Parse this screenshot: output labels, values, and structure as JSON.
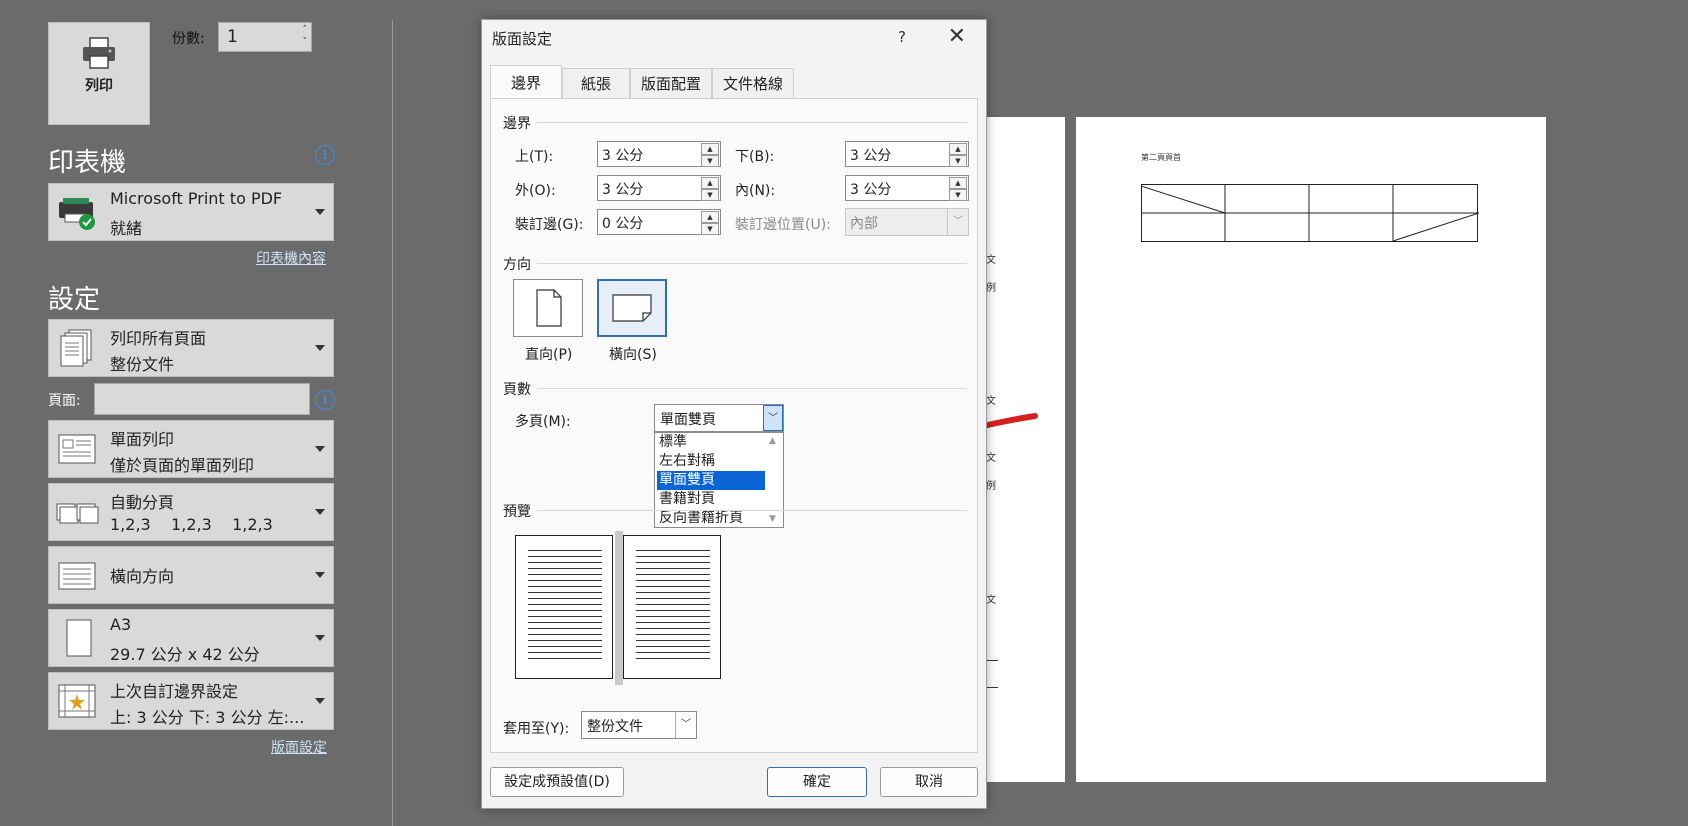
{
  "backstage": {
    "print_label": "列印",
    "copies_label": "份數:",
    "copies_value": "1",
    "printer_title": "印表機",
    "printer_name": "Microsoft Print to PDF",
    "printer_status": "就緒",
    "printer_properties_link": "印表機內容",
    "settings_title": "設定",
    "pages_label": "頁面:",
    "pages_value": "",
    "page_setup_link": "版面設定",
    "settings": [
      {
        "line1": "列印所有頁面",
        "line2": "整份文件",
        "icon": "pages-stack-icon"
      },
      {
        "line1": "單面列印",
        "line2": "僅於頁面的單面列印",
        "icon": "one-sided-icon"
      },
      {
        "line1": "自動分頁",
        "line2": "1,2,3    1,2,3    1,2,3",
        "icon": "collated-icon"
      },
      {
        "line1": "橫向方向",
        "line2": "",
        "icon": "landscape-page-icon"
      },
      {
        "line1": "A3",
        "line2": "29.7 公分 x 42 公分",
        "icon": "paper-size-icon"
      },
      {
        "line1": "上次自訂邊界設定",
        "line2": "上: 3 公分 下: 3 公分 左:...",
        "icon": "custom-margins-icon"
      }
    ]
  },
  "preview": {
    "heading": "第二頁頁首",
    "back_sheet_chars": [
      "文",
      "例",
      "文",
      "文",
      "例",
      "文"
    ]
  },
  "dialog": {
    "title": "版面設定",
    "help": "?",
    "close": "✕",
    "tabs": [
      "邊界",
      "紙張",
      "版面配置",
      "文件格線"
    ],
    "active_tab": "邊界",
    "margins_group": "邊界",
    "fields": {
      "top_label": "上(T):",
      "top_value": "3 公分",
      "bottom_label": "下(B):",
      "bottom_value": "3 公分",
      "outside_label": "外(O):",
      "outside_value": "3 公分",
      "inside_label": "內(N):",
      "inside_value": "3 公分",
      "gutter_label": "裝訂邊(G):",
      "gutter_value": "0 公分",
      "gutter_pos_label": "裝訂邊位置(U):",
      "gutter_pos_value": "內部"
    },
    "orientation_group": "方向",
    "portrait_label": "直向(P)",
    "landscape_label": "橫向(S)",
    "pages_group": "頁數",
    "multiple_pages_label": "多頁(M):",
    "multiple_pages_value": "單面雙頁",
    "multiple_pages_options": [
      "標準",
      "左右對稱",
      "單面雙頁",
      "書籍對頁",
      "反向書籍折頁"
    ],
    "multiple_pages_selected_index": 2,
    "preview_group": "預覽",
    "apply_to_label": "套用至(Y):",
    "apply_to_value": "整份文件",
    "set_default_button": "設定成預設值(D)",
    "ok_button": "確定",
    "cancel_button": "取消"
  },
  "colors": {
    "background": "#6b6b6b",
    "accent_blue": "#0a64d6",
    "annotation_red": "#d62020"
  }
}
